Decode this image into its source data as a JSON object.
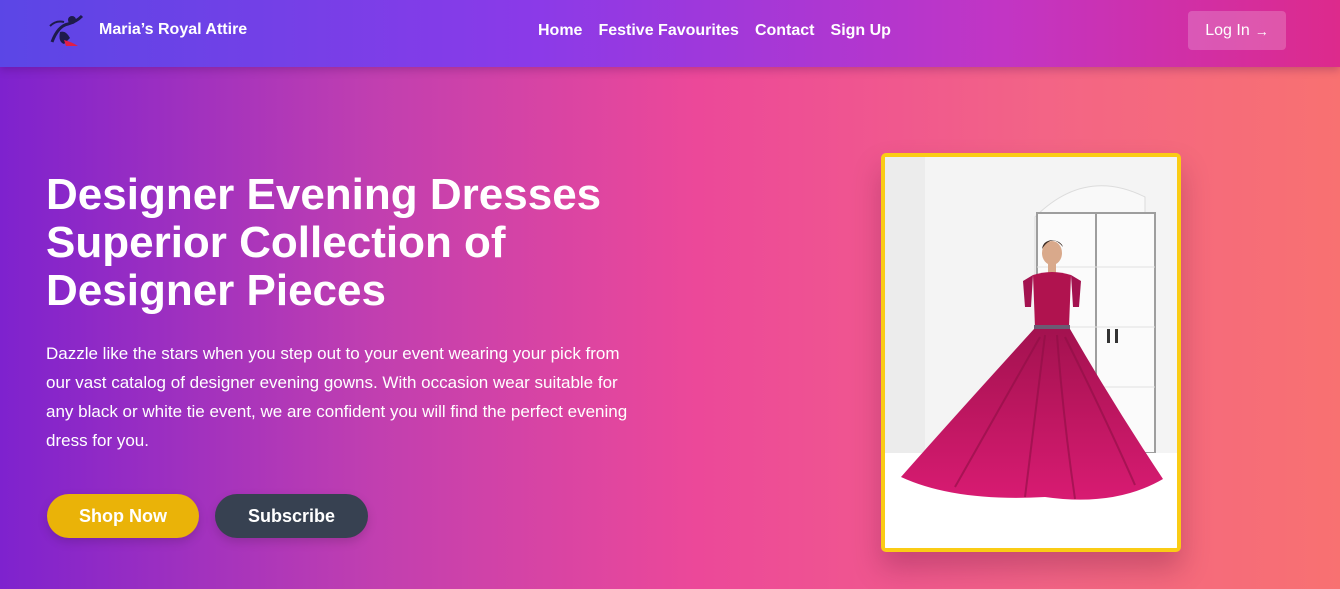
{
  "nav": {
    "brand_name": "Maria’s Royal Attire",
    "logo_icon": "dancer-logo-icon",
    "links": [
      "Home",
      "Festive Favourites",
      "Contact",
      "Sign Up"
    ],
    "login_label": "Log In",
    "login_icon": "arrow-right-icon"
  },
  "hero": {
    "title_lines": [
      "Designer Evening Dresses",
      "Superior Collection of",
      "Designer Pieces"
    ],
    "description": "Dazzle like the stars when you step out to your event wearing your pick from our vast catalog of designer evening gowns. With occasion wear suitable for any black or white tie event, we are confident you will find the perfect evening dress for you.",
    "primary_button": "Shop Now",
    "secondary_button": "Subscribe"
  },
  "colors": {
    "accent_yellow": "#eab308",
    "dark_button": "#374151",
    "frame_border": "#facc15",
    "dress": "#c2185b"
  }
}
